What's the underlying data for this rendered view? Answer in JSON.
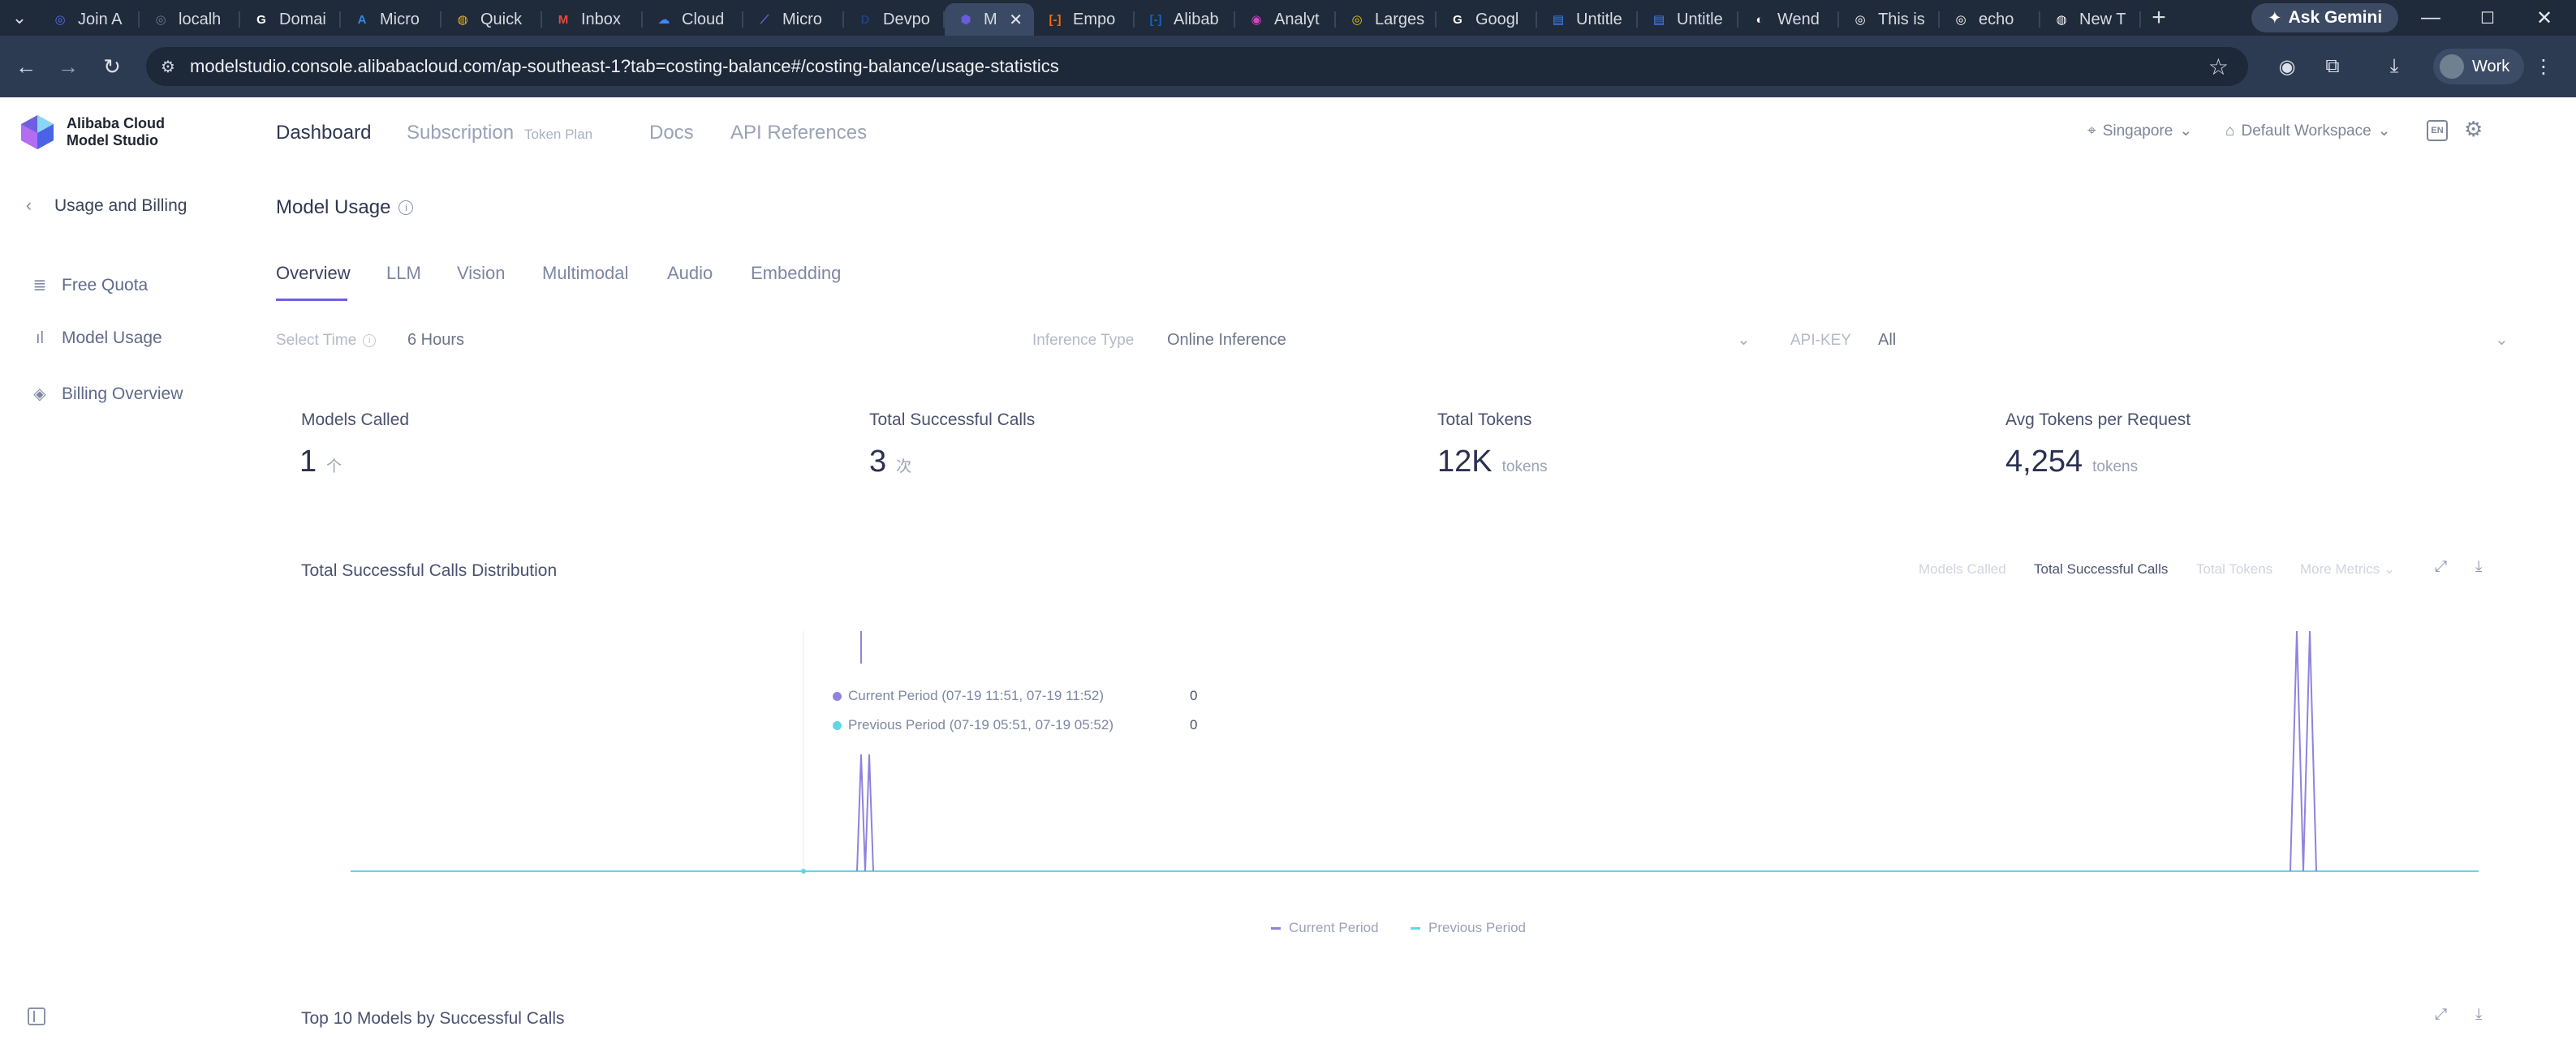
{
  "browser": {
    "tabs": [
      {
        "label": "Join A",
        "icon": "globe-icon",
        "color": "#4f6df5"
      },
      {
        "label": "localh",
        "icon": "globe-icon",
        "color": "#6b7a8f"
      },
      {
        "label": "Domai",
        "icon": "google-icon",
        "color": "#ffffff"
      },
      {
        "label": "Micro",
        "icon": "azure-icon",
        "color": "#2f8ae6"
      },
      {
        "label": "Quick",
        "icon": "chrome-icon",
        "color": "#f3b51b"
      },
      {
        "label": "Inbox",
        "icon": "gmail-icon",
        "color": "#e84b3c"
      },
      {
        "label": "Cloud",
        "icon": "cloud-icon",
        "color": "#4285f4"
      },
      {
        "label": "Micro",
        "icon": "foundry-icon",
        "color": "#6a5cd8"
      },
      {
        "label": "Devpo",
        "icon": "devpost-icon",
        "color": "#1d3f8a"
      },
      {
        "label": "M",
        "icon": "modelstudio-icon",
        "color": "#6a5cd8",
        "active": true
      },
      {
        "label": "Empo",
        "icon": "alibaba-icon",
        "color": "#ff6a00"
      },
      {
        "label": "Alibab",
        "icon": "alibaba-icon",
        "color": "#1565c0"
      },
      {
        "label": "Analyt",
        "icon": "analytics-icon",
        "color": "#d047c6"
      },
      {
        "label": "Larges",
        "icon": "globe-icon",
        "color": "#f0c419"
      },
      {
        "label": "Googl",
        "icon": "google-icon",
        "color": "#ffffff"
      },
      {
        "label": "Untitle",
        "icon": "doc-icon",
        "color": "#4285f4"
      },
      {
        "label": "Untitle",
        "icon": "doc-icon",
        "color": "#4285f4"
      },
      {
        "label": "Wend",
        "icon": "github-icon",
        "color": "#ffffff"
      },
      {
        "label": "This is",
        "icon": "globe-icon",
        "color": "#ffffff"
      },
      {
        "label": "echo",
        "icon": "globe-icon",
        "color": "#ffffff"
      },
      {
        "label": "New T",
        "icon": "chrome-icon",
        "color": "#ffffff"
      }
    ],
    "gemini_label": "Ask Gemini",
    "url": "modelstudio.console.alibabacloud.com/ap-southeast-1?tab=costing-balance#/costing-balance/usage-statistics",
    "profile_label": "Work"
  },
  "header": {
    "logo_line1": "Alibaba Cloud",
    "logo_line2": "Model Studio",
    "nav": {
      "dashboard": "Dashboard",
      "subscription": "Subscription",
      "token_plan": "Token Plan",
      "docs": "Docs",
      "api_references": "API References"
    },
    "region": "Singapore",
    "workspace": "Default Workspace",
    "lang": "EN"
  },
  "sidebar": {
    "back_label": "Usage and Billing",
    "items": [
      {
        "label": "Free Quota",
        "icon": "database-icon"
      },
      {
        "label": "Model Usage",
        "icon": "bar-chart-icon"
      },
      {
        "label": "Billing Overview",
        "icon": "layers-icon"
      }
    ]
  },
  "main": {
    "title": "Model Usage",
    "tabs": [
      "Overview",
      "LLM",
      "Vision",
      "Multimodal",
      "Audio",
      "Embedding"
    ],
    "filters": {
      "select_time_label": "Select Time",
      "select_time_value": "6 Hours",
      "inference_type_label": "Inference Type",
      "inference_type_value": "Online Inference",
      "api_key_label": "API-KEY",
      "api_key_value": "All"
    },
    "stats": [
      {
        "label": "Models Called",
        "value": "1",
        "unit": "个"
      },
      {
        "label": "Total Successful Calls",
        "value": "3",
        "unit": "次"
      },
      {
        "label": "Total Tokens",
        "value": "12K",
        "unit": "tokens"
      },
      {
        "label": "Avg Tokens per Request",
        "value": "4,254",
        "unit": "tokens"
      }
    ],
    "distribution_title": "Total Successful Calls Distribution",
    "metric_tabs": [
      "Models Called",
      "Total Successful Calls",
      "Total Tokens",
      "More Metrics"
    ],
    "top_models_title": "Top 10 Models by Successful Calls"
  },
  "chart_data": {
    "type": "line",
    "series": [
      {
        "name": "Current Period",
        "color": "#8e83de"
      },
      {
        "name": "Previous Period",
        "color": "#5fd8e6"
      }
    ],
    "tooltip": [
      {
        "label": "Current Period (07-19 11:51, 07-19 11:52)",
        "value": "0"
      },
      {
        "label": "Previous Period (07-19 05:51, 07-19 05:52)",
        "value": "0"
      }
    ],
    "legend": [
      "Current Period",
      "Previous Period"
    ],
    "grid": false,
    "legend_position": "bottom-center"
  }
}
